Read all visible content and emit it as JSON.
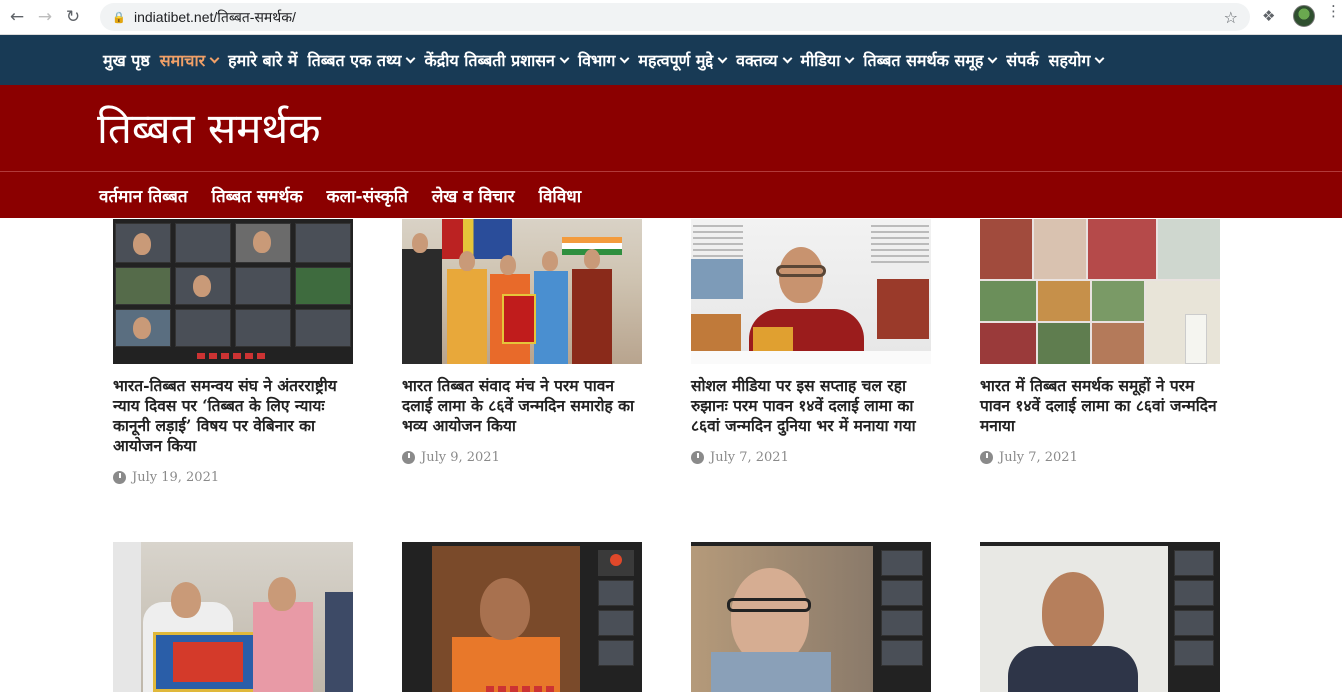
{
  "browser": {
    "url": "indiatibet.net/तिब्बत-समर्थक/"
  },
  "topnav": {
    "items": [
      {
        "label": "मुख पृष्ठ",
        "caret": false
      },
      {
        "label": "समाचार",
        "caret": true,
        "active": true
      },
      {
        "label": "हमारे बारे में",
        "caret": false
      },
      {
        "label": "तिब्बत एक तथ्य",
        "caret": true
      },
      {
        "label": "केंद्रीय तिब्बती प्रशासन",
        "caret": true
      },
      {
        "label": "विभाग",
        "caret": true
      },
      {
        "label": "महत्वपूर्ण मुद्दे",
        "caret": true
      },
      {
        "label": "वक्तव्य",
        "caret": true
      },
      {
        "label": "मीडिया",
        "caret": true
      },
      {
        "label": "तिब्बत समर्थक समूह",
        "caret": true
      },
      {
        "label": "संपर्क",
        "caret": false
      },
      {
        "label": "सहयोग",
        "caret": true
      }
    ]
  },
  "header": {
    "title": "तिब्बत समर्थक"
  },
  "subnav": {
    "items": [
      "वर्तमान तिब्बत",
      "तिब्बत समर्थक",
      "कला-संस्कृति",
      "लेख व विचार",
      "विविधा"
    ]
  },
  "articles": [
    {
      "title": "भारत-तिब्बत समन्वय संघ ने अंतरराष्ट्रीय न्याय दिवस पर ‘तिब्बत के लिए न्यायः कानूनी लड़ाई’ विषय पर वेबिनार का आयोजन किया",
      "date": "July 19, 2021"
    },
    {
      "title": "भारत तिब्बत संवाद मंच ने परम पावन दलाई लामा के ८६वें जन्मदिन समारोह का भव्य आयोजन किया",
      "date": "July 9, 2021"
    },
    {
      "title": "सोशल मीडिया पर इस सप्ताह चल रहा रुझानः परम पावन १४वें दलाई लामा का ८६वां जन्मदिन दुनिया भर में मनाया गया",
      "date": "July 7, 2021"
    },
    {
      "title": "भारत में तिब्बत समर्थक समूहों ने परम पावन १४वें दलाई लामा का ८६वां जन्मदिन मनाया",
      "date": "July 7, 2021"
    }
  ],
  "colors": {
    "topnav_bg": "#183a55",
    "header_bg": "#8b0000",
    "active_nav": "#f0a068"
  }
}
